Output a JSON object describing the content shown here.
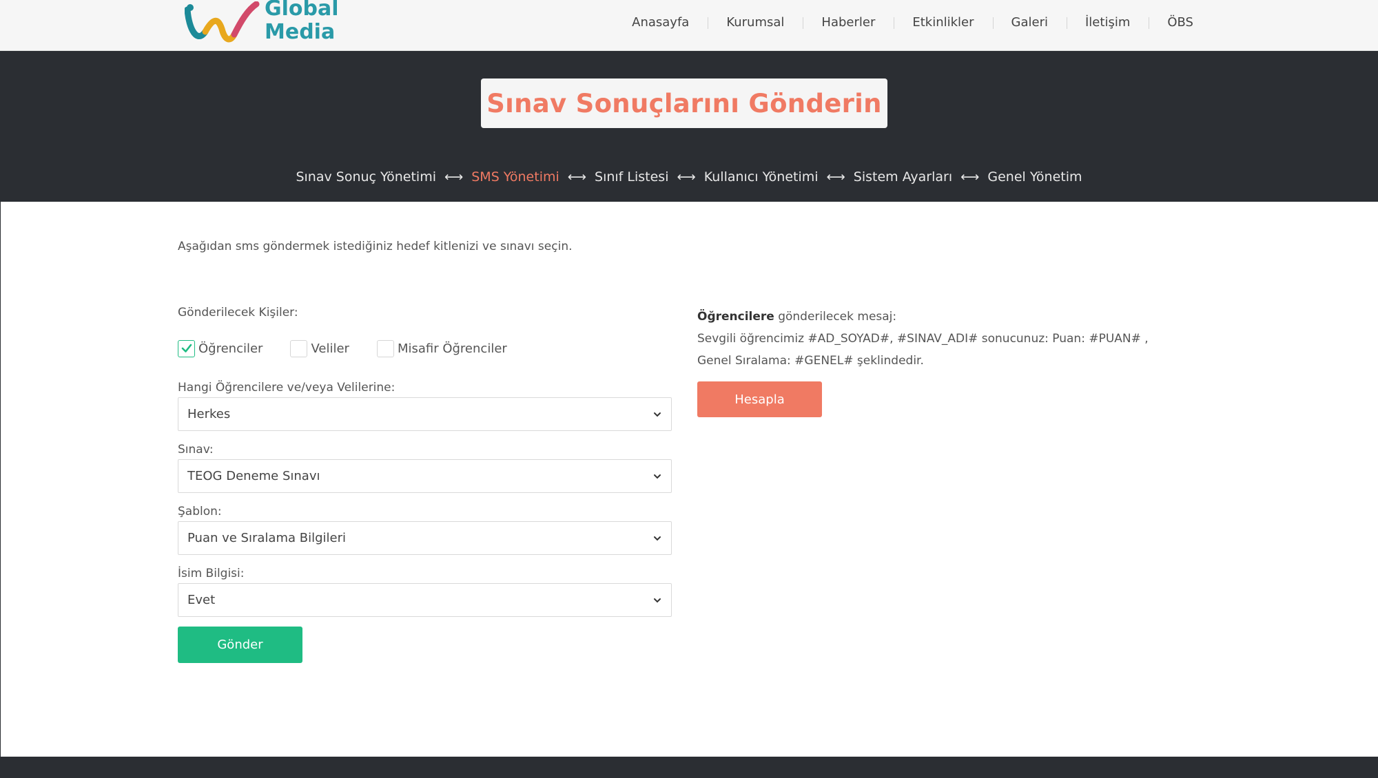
{
  "brand": {
    "line1": "Global",
    "line2": "Media"
  },
  "nav": [
    "Anasayfa",
    "Kurumsal",
    "Haberler",
    "Etkinlikler",
    "Galeri",
    "İletişim",
    "ÖBS"
  ],
  "hero": {
    "title": "Sınav Sonuçlarını Gönderin"
  },
  "breadcrumb": {
    "items": [
      {
        "label": "Sınav Sonuç Yönetimi",
        "active": false
      },
      {
        "label": "SMS Yönetimi",
        "active": true
      },
      {
        "label": "Sınıf Listesi",
        "active": false
      },
      {
        "label": "Kullanıcı Yönetimi",
        "active": false
      },
      {
        "label": "Sistem Ayarları",
        "active": false
      },
      {
        "label": "Genel Yönetim",
        "active": false
      }
    ],
    "separator": "⟷"
  },
  "intro": "Aşağıdan sms göndermek istediğiniz hedef kitlenizi ve sınavı seçin.",
  "recipients": {
    "label": "Gönderilecek Kişiler:",
    "options": [
      {
        "label": "Öğrenciler",
        "checked": true
      },
      {
        "label": "Veliler",
        "checked": false
      },
      {
        "label": "Misafir Öğrenciler",
        "checked": false
      }
    ]
  },
  "selects": {
    "target": {
      "label": "Hangi Öğrencilere ve/veya Velilerine:",
      "value": "Herkes"
    },
    "exam": {
      "label": "Sınav:",
      "value": "TEOG Deneme Sınavı"
    },
    "template": {
      "label": "Şablon:",
      "value": "Puan ve Sıralama Bilgileri"
    },
    "name_info": {
      "label": "İsim Bilgisi:",
      "value": "Evet"
    }
  },
  "send_button": "Gönder",
  "message": {
    "bold": "Öğrencilere",
    "head_rest": " gönderilecek mesaj:",
    "line1": "Sevgili öğrencimiz  #AD_SOYAD#, #SINAV_ADI# sonucunuz: Puan: #PUAN# ,",
    "line2": "Genel Sıralama: #GENEL# şeklindedir."
  },
  "calc_button": "Hesapla",
  "colors": {
    "accent": "#f07a63",
    "green": "#1fbc83",
    "dark": "#2b2e33",
    "logo": "#2a9aa8"
  }
}
